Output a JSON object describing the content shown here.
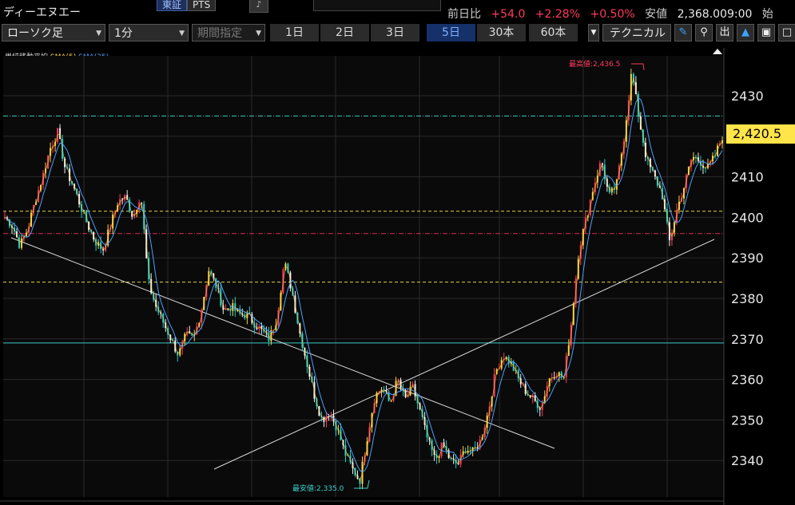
{
  "symbol": {
    "name": "ディーエヌエー"
  },
  "market_tabs": [
    {
      "label": "東証",
      "active": true
    },
    {
      "label": "PTS",
      "active": false
    }
  ],
  "quote": {
    "change_label": "前日比",
    "change": "+54.0",
    "change_pct": "+2.28%",
    "ratio_pct": "+0.50%",
    "low_label": "安値",
    "low_value": "2,368.0",
    "low_time": "09:00",
    "open_label": "始"
  },
  "toolbar": {
    "chart_type": "ローソク足",
    "interval": "1分",
    "range_select": "期間指定",
    "periods": [
      "1日",
      "2日",
      "3日",
      "5日",
      "30本",
      "60本"
    ],
    "active_period": "5日",
    "technical_label": "テクニカル",
    "icons": [
      "pen-icon",
      "zoom-icon",
      "output-icon",
      "area-chart-icon",
      "save-icon",
      "expand-icon"
    ],
    "output_glyph": "出"
  },
  "indicator": {
    "name": "単純移動平均",
    "sma5": "SMA(5)",
    "sma25": "SMA(25)"
  },
  "annotations": {
    "high": "最高値:2,436.5",
    "low": "最安値:2,335.0"
  },
  "current_price": "2,420.5",
  "colors": {
    "up": "#ff3b5c",
    "sma5": "#ffd040",
    "sma25": "#4aa0ff",
    "price_tag": "#ffe44a",
    "low_annot": "#40d0d0",
    "high_annot": "#ff3b5c"
  },
  "chart_data": {
    "type": "candlestick",
    "yaxis_ticks": [
      2340,
      2350,
      2360,
      2370,
      2380,
      2390,
      2400,
      2410,
      2420,
      2430
    ],
    "ylim": [
      2334,
      2446
    ],
    "high": 2436.5,
    "low": 2335.0,
    "last": 2420.5,
    "hlines": [
      {
        "value": 2425,
        "style": "dashdot",
        "color": "#3fc8c8"
      },
      {
        "value": 2401.5,
        "style": "dashed",
        "color": "#e8d23a"
      },
      {
        "value": 2396,
        "style": "dashdot",
        "color": "#d03050"
      },
      {
        "value": 2384,
        "style": "dashed",
        "color": "#e8d23a"
      },
      {
        "value": 2369,
        "style": "solid",
        "color": "#3fc8c8"
      }
    ],
    "close_path": [
      2400,
      2398,
      2393,
      2397,
      2404,
      2410,
      2417,
      2421,
      2412,
      2408,
      2403,
      2398,
      2394,
      2392,
      2398,
      2404,
      2405,
      2400,
      2406,
      2384,
      2378,
      2374,
      2370,
      2366,
      2371,
      2370,
      2377,
      2387,
      2383,
      2377,
      2378,
      2376,
      2376,
      2374,
      2372,
      2370,
      2375,
      2389,
      2382,
      2372,
      2364,
      2356,
      2350,
      2352,
      2348,
      2342,
      2338,
      2335,
      2346,
      2356,
      2358,
      2354,
      2360,
      2355,
      2358,
      2352,
      2345,
      2340,
      2344,
      2340,
      2339,
      2343,
      2342,
      2345,
      2352,
      2362,
      2366,
      2364,
      2360,
      2357,
      2355,
      2353,
      2360,
      2362,
      2360,
      2374,
      2392,
      2400,
      2408,
      2414,
      2405,
      2408,
      2420,
      2436,
      2424,
      2414,
      2410,
      2406,
      2394,
      2402,
      2408,
      2415,
      2414,
      2412,
      2415,
      2420
    ]
  }
}
